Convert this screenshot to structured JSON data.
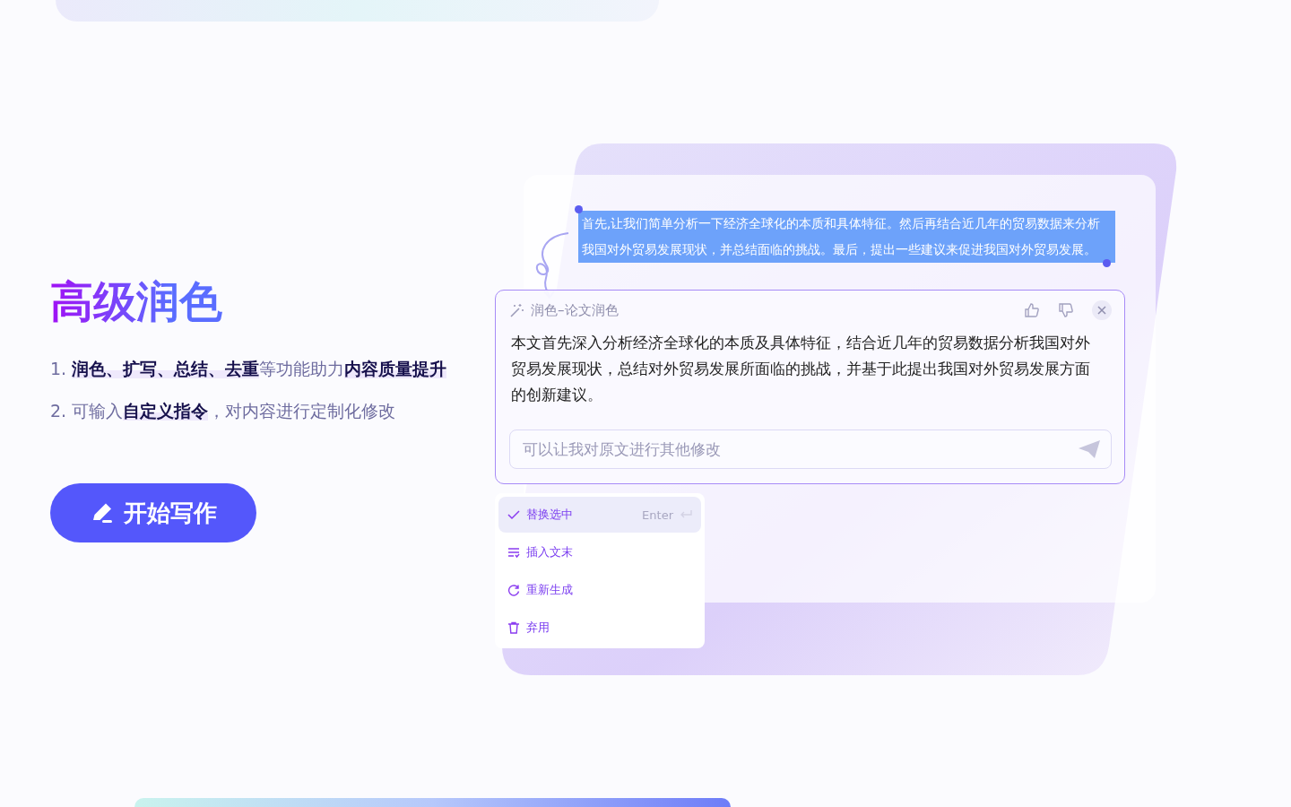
{
  "heading": "高级润色",
  "features": [
    {
      "number": "1.",
      "text": "**润色、扩写、总结、去重**等功能助力**内容质量提升**"
    },
    {
      "number": "2.",
      "text": "可输入**自定义指令**，对内容进行定制化修改"
    }
  ],
  "cta": "开始写作",
  "demo": {
    "selected_text": "首先,让我们简单分析一下经济全球化的本质和具体特征。然后再结合近几年的贸易数据来分析我国对外贸易发展现状，并总结面临的挑战。最后，提出一些建议来促进我国对外贸易发展。",
    "panel": {
      "title": "润色–论文润色",
      "result": "本文首先深入分析经济全球化的本质及具体特征，结合近几年的贸易数据分析我国对外贸易发展现状，总结对外贸易发展所面临的挑战，并基于此提出我国对外贸易发展方面的创新建议。",
      "input": {
        "placeholder": "可以让我对原文进行其他修改"
      }
    },
    "menu": [
      {
        "kind": "check",
        "label": "替换选中",
        "selected": true,
        "shortcut": "Enter"
      },
      {
        "kind": "insert",
        "label": "插入文末",
        "selected": false
      },
      {
        "kind": "refresh",
        "label": "重新生成",
        "selected": false
      },
      {
        "kind": "trash",
        "label": "弃用",
        "selected": false
      }
    ]
  }
}
